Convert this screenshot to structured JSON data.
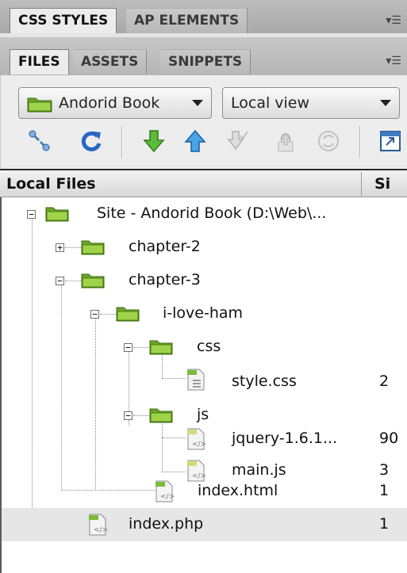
{
  "panel_top": {
    "tabs": [
      "CSS STYLES",
      "AP ELEMENTS"
    ]
  },
  "panel_files": {
    "tabs": [
      "FILES",
      "ASSETS",
      "SNIPPETS"
    ]
  },
  "toolbar": {
    "site_select": "Andorid Book",
    "view_select": "Local view",
    "buttons": [
      "connect",
      "refresh",
      "get",
      "put",
      "check-in",
      "check-out",
      "synchronize",
      "expand"
    ]
  },
  "columns": {
    "name": "Local Files",
    "size": "Si"
  },
  "tree": [
    {
      "name": "Site - Andorid Book (D:\\Web\\...",
      "type": "site",
      "size": ""
    },
    {
      "name": "chapter-2",
      "type": "folder",
      "size": ""
    },
    {
      "name": "chapter-3",
      "type": "folder",
      "size": ""
    },
    {
      "name": "i-love-ham",
      "type": "folder",
      "size": ""
    },
    {
      "name": "css",
      "type": "folder",
      "size": ""
    },
    {
      "name": "style.css",
      "type": "css-file",
      "size": "2"
    },
    {
      "name": "js",
      "type": "folder",
      "size": ""
    },
    {
      "name": "jquery-1.6.1...",
      "type": "js-file",
      "size": "90"
    },
    {
      "name": "main.js",
      "type": "js-file",
      "size": "3"
    },
    {
      "name": "index.html",
      "type": "html-file",
      "size": "1"
    },
    {
      "name": "index.php",
      "type": "php-file",
      "size": "1",
      "selected": true
    }
  ]
}
